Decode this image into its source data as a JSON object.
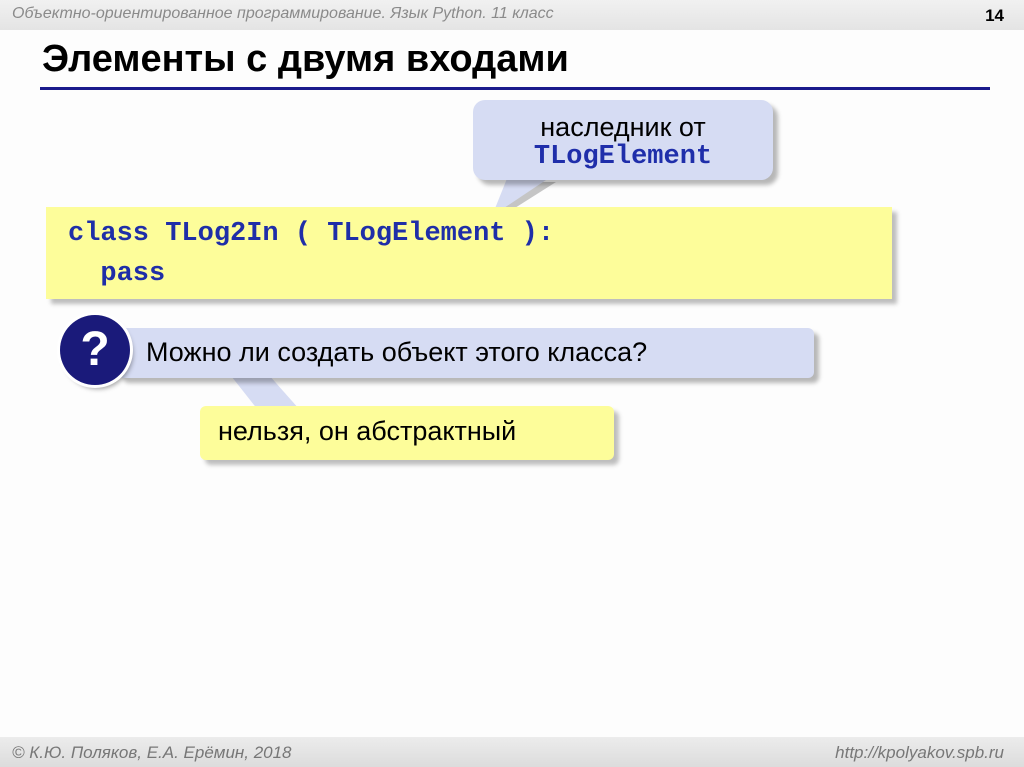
{
  "header": {
    "course": "Объектно-ориентированное программирование. Язык Python. 11 класс",
    "slide_number": "14"
  },
  "slide": {
    "title": "Элементы с двумя входами",
    "callout": {
      "line1": "наследник от",
      "line2": "TLogElement"
    },
    "code": {
      "line1": "class TLog2In ( TLogElement ):",
      "line2": "  pass"
    },
    "question": {
      "mark": "?",
      "text": "Можно ли создать объект этого класса?"
    },
    "answer": "нельзя, он абстрактный"
  },
  "footer": {
    "copyright": "© К.Ю. Поляков, Е.А. Ерёмин, 2018",
    "url": "http://kpolyakov.spb.ru"
  },
  "colors": {
    "title_rule": "#1a1a8c",
    "code_text": "#1f2ea8",
    "callout_bg": "#d6dcf3",
    "highlight_bg": "#fdfd9a",
    "question_circle": "#1a1a7a"
  }
}
